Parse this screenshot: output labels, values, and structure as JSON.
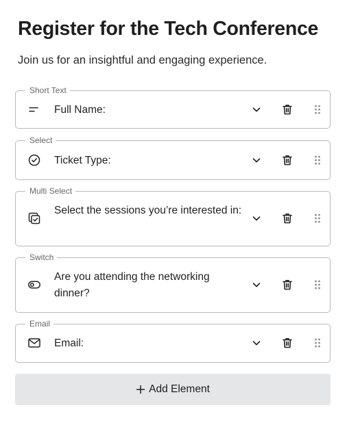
{
  "header": {
    "title": "Register for the Tech Conference",
    "subtitle": "Join us for an insightful and engaging experience."
  },
  "fields": [
    {
      "type_label": "Short Text",
      "label": "Full Name:",
      "icon": "short-text-icon"
    },
    {
      "type_label": "Select",
      "label": "Ticket Type:",
      "icon": "circle-check-icon"
    },
    {
      "type_label": "Multi Select",
      "label": "Select the sessions you’re interested in:",
      "icon": "multi-select-icon"
    },
    {
      "type_label": "Switch",
      "label": "Are you attending the networking dinner?",
      "icon": "toggle-icon"
    },
    {
      "type_label": "Email",
      "label": "Email:",
      "icon": "envelope-icon"
    }
  ],
  "add_button": {
    "label": "Add Element",
    "icon": "plus-icon"
  }
}
